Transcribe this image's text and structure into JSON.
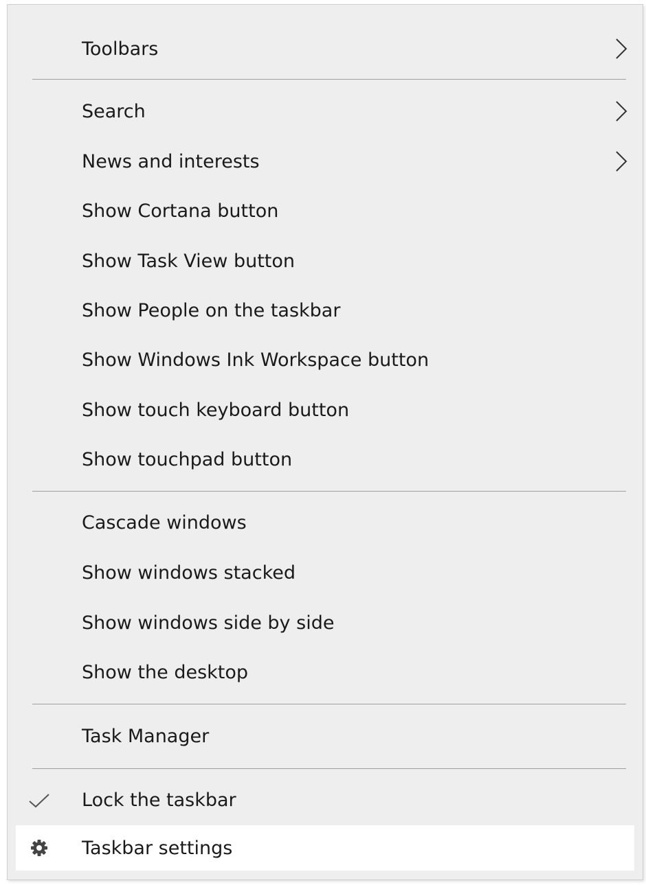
{
  "menu": {
    "items": [
      {
        "label": "Toolbars",
        "submenu": true
      },
      {
        "label": "Search",
        "submenu": true
      },
      {
        "label": "News and interests",
        "submenu": true
      },
      {
        "label": "Show Cortana button"
      },
      {
        "label": "Show Task View button"
      },
      {
        "label": "Show People on the taskbar"
      },
      {
        "label": "Show Windows Ink Workspace button"
      },
      {
        "label": "Show touch keyboard button"
      },
      {
        "label": "Show touchpad button"
      },
      {
        "label": "Cascade windows"
      },
      {
        "label": "Show windows stacked"
      },
      {
        "label": "Show windows side by side"
      },
      {
        "label": "Show the desktop"
      },
      {
        "label": "Task Manager"
      },
      {
        "label": "Lock the taskbar",
        "checked": true,
        "icon": "checkmark-icon"
      },
      {
        "label": "Taskbar settings",
        "icon": "gear-icon",
        "highlighted": true
      }
    ]
  },
  "colors": {
    "menu_background": "#eeeeee",
    "highlight_background": "#ffffff",
    "separator": "#9e9e9e",
    "text": "#1a1a1a"
  }
}
